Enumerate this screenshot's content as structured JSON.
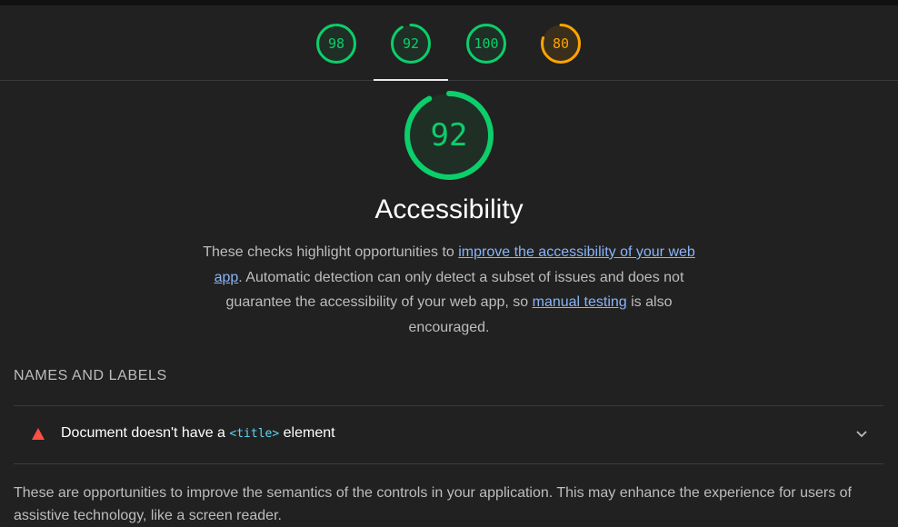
{
  "colors": {
    "background": "#212121",
    "pass": "#0cce6b",
    "average": "#ffa400",
    "fail": "#ff4e42",
    "link": "#8ab4f8",
    "code": "#5fd3f3"
  },
  "gauges": [
    {
      "score": "98",
      "value": 98,
      "rating": "pass",
      "active": false
    },
    {
      "score": "92",
      "value": 92,
      "rating": "pass",
      "active": true
    },
    {
      "score": "100",
      "value": 100,
      "rating": "pass",
      "active": false
    },
    {
      "score": "80",
      "value": 80,
      "rating": "average",
      "active": false
    }
  ],
  "category": {
    "score": "92",
    "value": 92,
    "title": "Accessibility",
    "description": {
      "part1": "These checks highlight opportunities to ",
      "link1": "improve the accessibility of your web app",
      "part2": ". Automatic detection can only detect a subset of issues and does not guarantee the accessibility of your web app, so ",
      "link2": "manual testing",
      "part3": " is also encouraged."
    }
  },
  "group": {
    "title": "NAMES AND LABELS",
    "description": "These are opportunities to improve the semantics of the controls in your application. This may enhance the experience for users of assistive technology, like a screen reader."
  },
  "audit": {
    "status_icon": "fail-triangle-icon",
    "title_before": "Document doesn't have a ",
    "title_code": "<title>",
    "title_after": " element",
    "expand_icon": "chevron-down-icon"
  }
}
